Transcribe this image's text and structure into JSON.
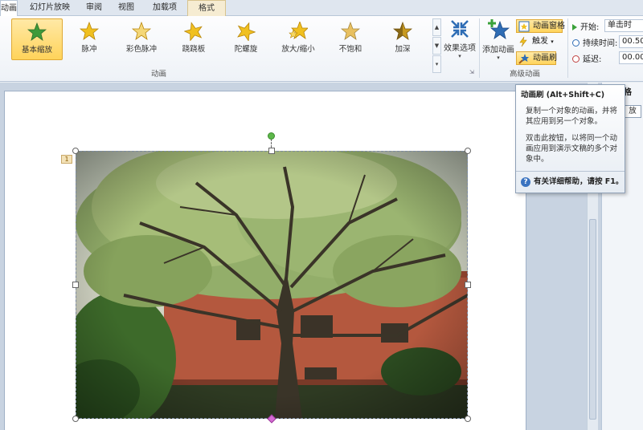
{
  "tabs": [
    {
      "label": "动画"
    },
    {
      "label": "幻灯片放映"
    },
    {
      "label": "审阅"
    },
    {
      "label": "视图"
    },
    {
      "label": "加载项"
    },
    {
      "label": "格式"
    }
  ],
  "animations": [
    {
      "label": "基本缩放",
      "color": "#3e9a3a",
      "selected": true
    },
    {
      "label": "脉冲",
      "color": "#f0c020",
      "selected": false
    },
    {
      "label": "彩色脉冲",
      "color": "#f0c020",
      "selected": false
    },
    {
      "label": "跷跷板",
      "color": "#f0c020",
      "selected": false
    },
    {
      "label": "陀螺旋",
      "color": "#f0c020",
      "selected": false
    },
    {
      "label": "放大/缩小",
      "color": "#f0c020",
      "selected": false
    },
    {
      "label": "不饱和",
      "color": "#e8c060",
      "selected": false
    },
    {
      "label": "加深",
      "color": "#c89a20",
      "selected": false
    }
  ],
  "ribbon": {
    "effect_options_label": "效果选项",
    "group_animation": "动画",
    "add_animation_label": "添加动画",
    "animation_pane_label": "动画窗格",
    "trigger_label": "触发",
    "animation_painter_label": "动画刷",
    "group_advanced": "高级动画",
    "start_label": "开始:",
    "start_value": "单击时",
    "duration_label": "持续时间:",
    "duration_value": "00.50",
    "delay_label": "延迟:",
    "delay_value": "00.00"
  },
  "tooltip": {
    "title": "动画刷 (Alt+Shift+C)",
    "body1": "复制一个对象的动画，并将其应用到另一个对象。",
    "body2": "双击此按钮，以将同一个动画应用到演示文稿的多个对象中。",
    "help": "有关详细帮助，请按 F1。"
  },
  "slide": {
    "anim_badge": "1"
  },
  "pane": {
    "title_fragment": "格",
    "button_fragment": "放"
  }
}
